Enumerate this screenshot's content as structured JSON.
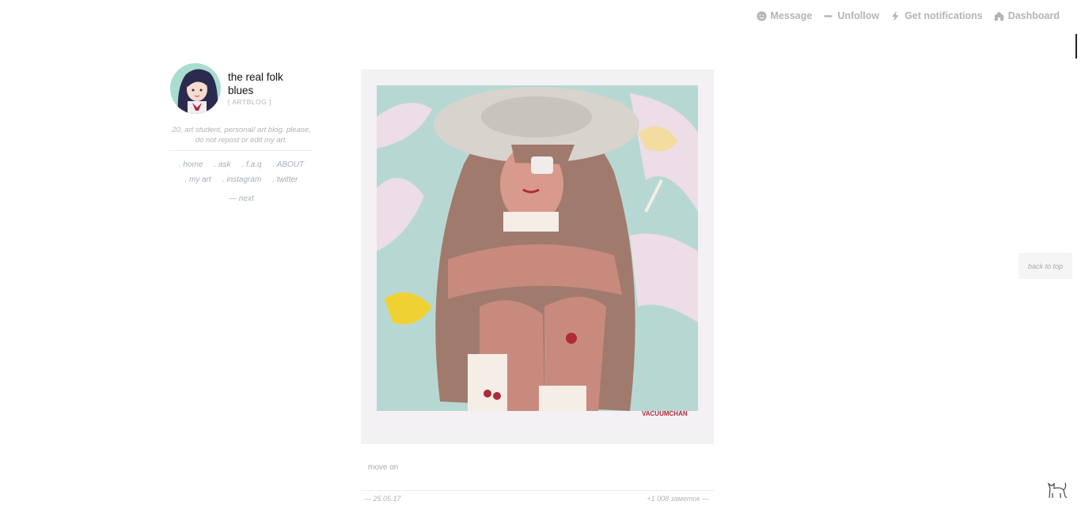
{
  "topbar": {
    "message": "Message",
    "unfollow": "Unfollow",
    "notifications": "Get notifications",
    "dashboard": "Dashboard"
  },
  "sidebar": {
    "title": "the real folk blues",
    "subtitle": "[ ARTBLOG ]",
    "description": "20, art student, personal/ art blog. please, do not repost or edit my art.",
    "nav": [
      ". home",
      ". ask",
      ". f.a.q",
      ". ABOUT",
      ". my art",
      ". instagram",
      ". twitter"
    ],
    "next": "— next"
  },
  "post": {
    "signature": "VACUUMCHAN",
    "caption": "move on",
    "date": "— 25.05.17",
    "notes": "+1 008 заметок —"
  },
  "back_to_top": "back to top",
  "colors": {
    "accent": "#a4adbd",
    "muted": "#b4b4b4"
  }
}
